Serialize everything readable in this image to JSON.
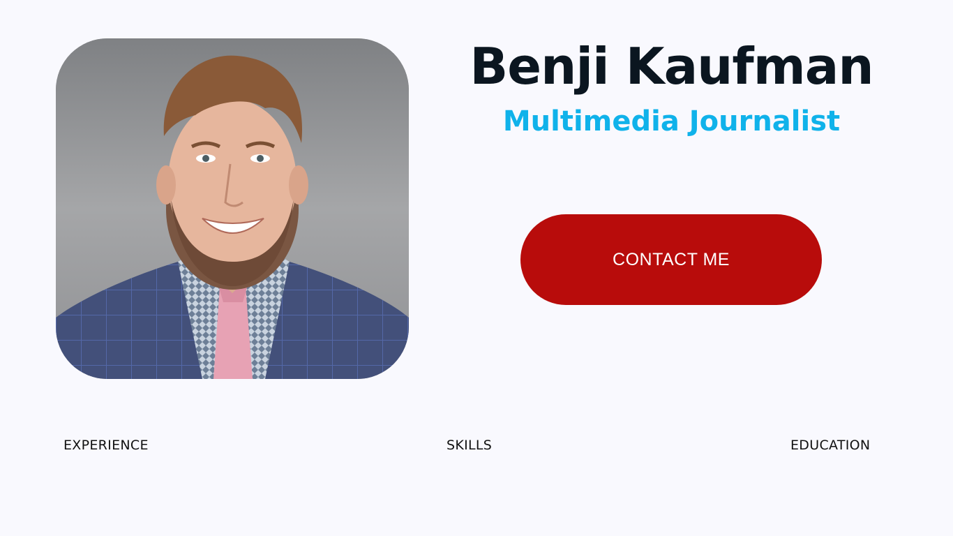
{
  "profile": {
    "name": "Benji Kaufman",
    "title": "Multimedia Journalist"
  },
  "contact": {
    "label": "CONTACT ME"
  },
  "nav": {
    "experience": "EXPERIENCE",
    "skills": "SKILLS",
    "education": "EDUCATION"
  },
  "colors": {
    "background": "#f9f9fe",
    "name": "#0b1620",
    "title_accent": "#10b2ea",
    "button": "#b80c0b",
    "button_text": "#ffffff"
  },
  "icons": {
    "portrait": "headshot-photo"
  }
}
